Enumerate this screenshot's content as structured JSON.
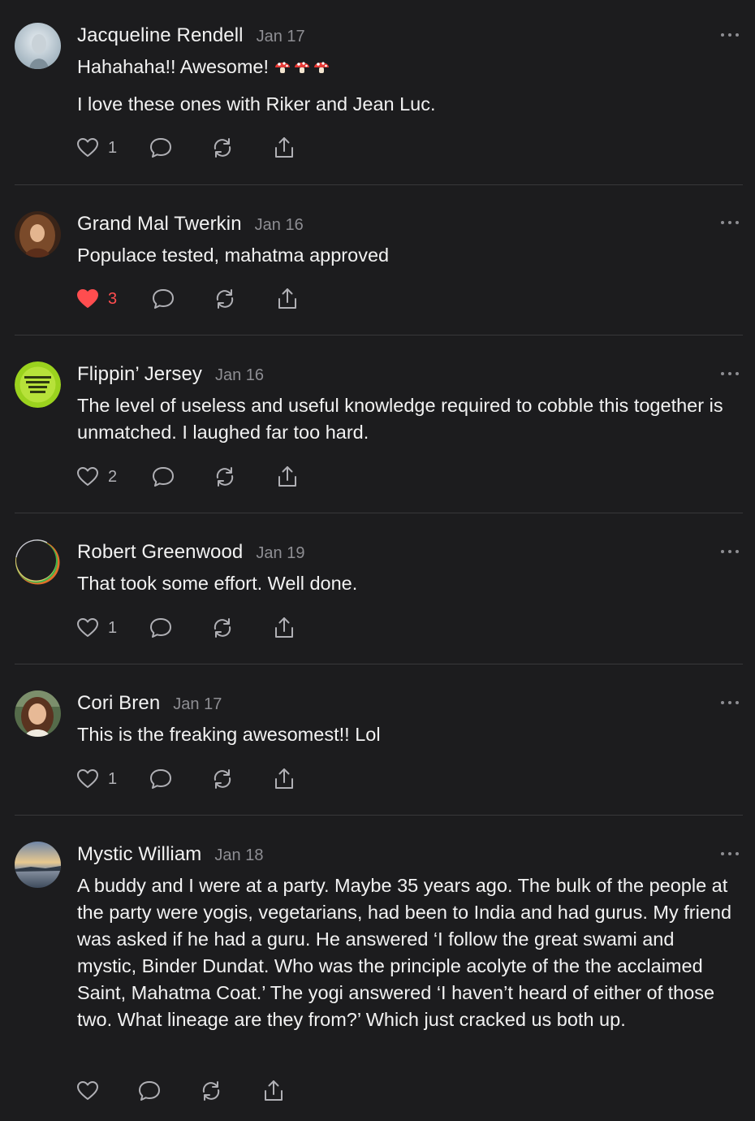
{
  "comments": [
    {
      "author": "Jacqueline Rendell",
      "date": "Jan 17",
      "paragraphs": [
        "Hahahaha!! Awesome!",
        "I love these ones with Riker and Jean Luc."
      ],
      "emoji": "mushroom",
      "emoji_count": 3,
      "likes": "1",
      "liked": false
    },
    {
      "author": "Grand Mal Twerkin",
      "date": "Jan 16",
      "paragraphs": [
        "Populace tested, mahatma approved"
      ],
      "likes": "3",
      "liked": true
    },
    {
      "author": "Flippin’ Jersey",
      "date": "Jan 16",
      "paragraphs": [
        "The level of useless and useful knowledge required to cobble this together is unmatched. I laughed far too hard."
      ],
      "likes": "2",
      "liked": false
    },
    {
      "author": "Robert Greenwood",
      "date": "Jan 19",
      "paragraphs": [
        "That took some effort. Well done."
      ],
      "likes": "1",
      "liked": false
    },
    {
      "author": "Cori Bren",
      "date": "Jan 17",
      "paragraphs": [
        "This is the freaking awesomest!! Lol"
      ],
      "likes": "1",
      "liked": false
    },
    {
      "author": "Mystic William",
      "date": "Jan 18",
      "paragraphs": [
        "A buddy and I were at a party. Maybe 35 years ago. The bulk of the people at the party were yogis, vegetarians, had been to India and had gurus. My friend was asked if he had a guru. He answered ‘I follow the great swami and mystic, Binder Dundat. Who was the principle acolyte of the the acclaimed Saint, Mahatma Coat.’ The yogi answered ‘I haven’t heard of either of those two. What lineage are they from?’ Which just cracked us both up."
      ],
      "likes": "",
      "liked": false
    }
  ],
  "colors": {
    "background": "#1c1c1e",
    "divider": "#38383a",
    "muted": "#8e8e93",
    "like_active": "#ff4d4f"
  }
}
